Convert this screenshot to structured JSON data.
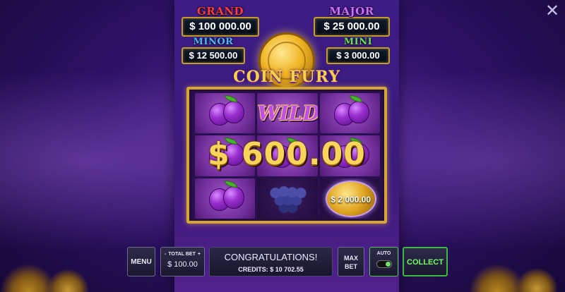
{
  "window": {
    "close_label": "✕"
  },
  "jackpots": {
    "grand": {
      "title": "GRAND",
      "amount": "$ 100 000.00",
      "color": "#ff3b3b"
    },
    "major": {
      "title": "MAJOR",
      "amount": "$ 25 000.00",
      "color": "#d46bff"
    },
    "minor": {
      "title": "MINOR",
      "amount": "$ 12 500.00",
      "color": "#4fb6ff"
    },
    "mini": {
      "title": "MINI",
      "amount": "$ 3 000.00",
      "color": "#6fe05a"
    }
  },
  "logo": {
    "text": "COIN FURY"
  },
  "reels": {
    "symbols": [
      [
        "plum",
        "wild",
        "plum"
      ],
      [
        "plum",
        "plum",
        "plum"
      ],
      [
        "plum",
        "grapes",
        "coin"
      ]
    ],
    "wild_text": "WILD",
    "coin_value": "$ 2 000.00"
  },
  "win": {
    "amount": "$ 600.00"
  },
  "controls": {
    "menu_label": "MENU",
    "total_bet_label": "TOTAL BET",
    "bet_minus": "-",
    "bet_plus": "+",
    "total_bet_value": "$ 100.00",
    "message": "CONGRATULATIONS!",
    "credits_text": "CREDITS: $ 10 702.55",
    "max_bet_line1": "MAX",
    "max_bet_line2": "BET",
    "auto_label": "AUTO",
    "auto_enabled": true,
    "collect_label": "COLLECT"
  }
}
